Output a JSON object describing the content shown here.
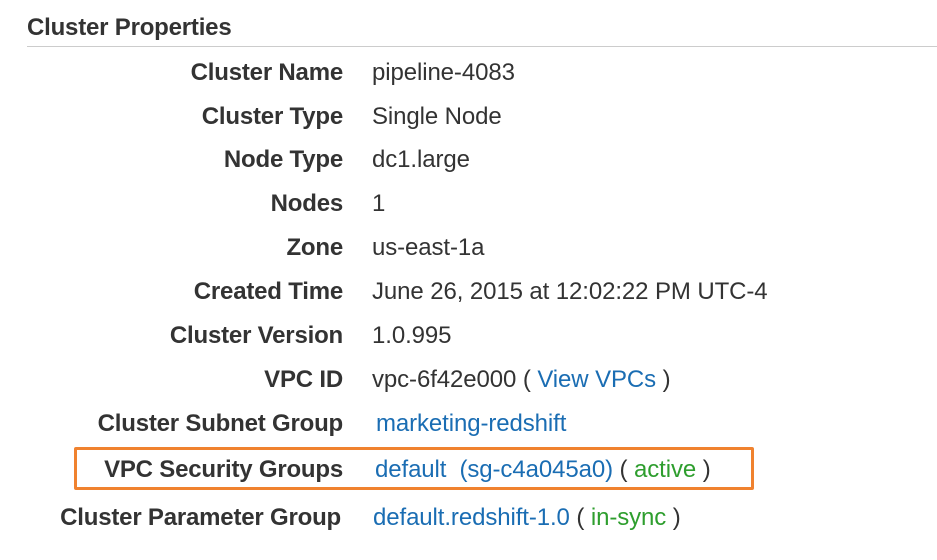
{
  "section": {
    "title": "Cluster Properties"
  },
  "properties": {
    "cluster_name": {
      "label": "Cluster Name",
      "value": "pipeline-4083"
    },
    "cluster_type": {
      "label": "Cluster Type",
      "value": "Single Node"
    },
    "node_type": {
      "label": "Node Type",
      "value": "dc1.large"
    },
    "nodes": {
      "label": "Nodes",
      "value": "1"
    },
    "zone": {
      "label": "Zone",
      "value": "us-east-1a"
    },
    "created_time": {
      "label": "Created Time",
      "value": "June 26, 2015 at 12:02:22 PM UTC-4"
    },
    "cluster_version": {
      "label": "Cluster Version",
      "value": "1.0.995"
    },
    "vpc_id": {
      "label": "VPC ID",
      "value": "vpc-6f42e000",
      "open_paren": "(",
      "link": "View VPCs",
      "close_paren": ")"
    },
    "subnet_group": {
      "label": "Cluster Subnet Group",
      "link": "marketing-redshift"
    },
    "security_groups": {
      "label": "VPC Security Groups",
      "link_name": "default",
      "link_id": "(sg-c4a045a0)",
      "open_paren": "(",
      "status": "active",
      "close_paren": ")"
    },
    "parameter_group": {
      "label": "Cluster Parameter Group",
      "link": "default.redshift-1.0",
      "open_paren": "(",
      "status": "in-sync",
      "close_paren": ")"
    }
  },
  "colors": {
    "link": "#1a6db3",
    "status_green": "#2e9e2e",
    "highlight": "#f0822f"
  }
}
